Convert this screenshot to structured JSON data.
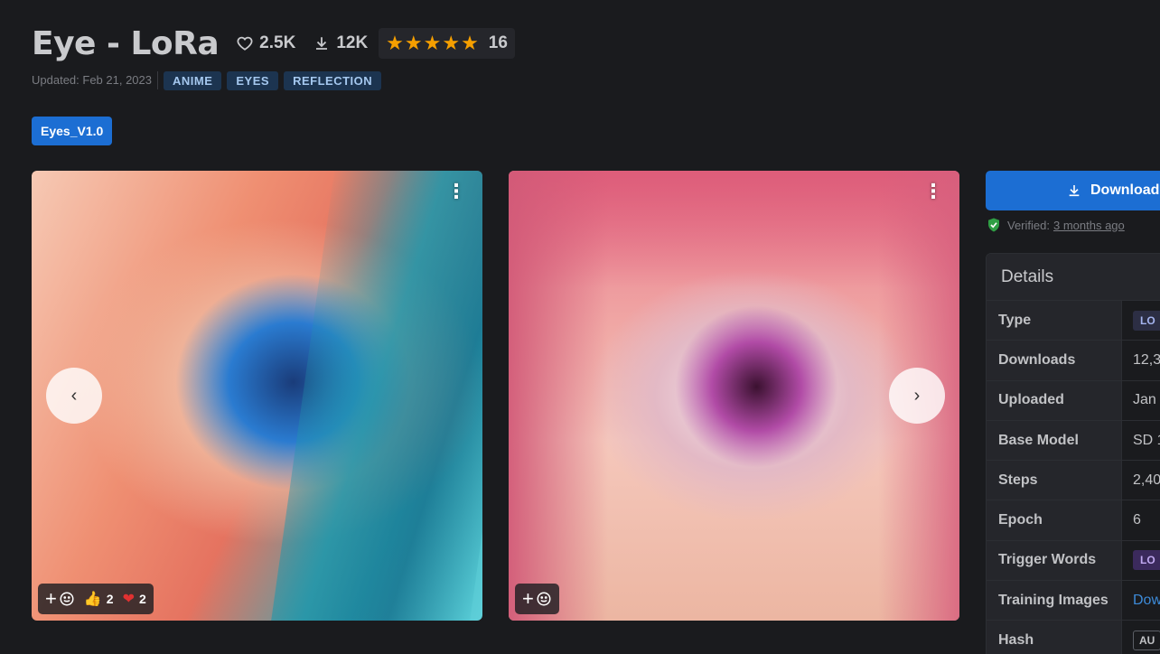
{
  "header": {
    "title": "Eye - LoRa",
    "likes": "2.5K",
    "downloads": "12K",
    "stars": "★★★★★",
    "rating_count": "16",
    "rating_value": 5,
    "updated": "Updated: Feb 21, 2023",
    "tags": [
      "ANIME",
      "EYES",
      "REFLECTION"
    ]
  },
  "version": {
    "label": "Eyes_V1.0"
  },
  "gallery": {
    "cards": [
      {
        "reactions": [
          {
            "icon": "👍",
            "count": "2"
          },
          {
            "icon": "❤",
            "count": "2"
          }
        ]
      },
      {
        "reactions": []
      }
    ],
    "prev_symbol": "‹",
    "next_symbol": "›",
    "menu_symbol": "⋮",
    "add_symbol": "+"
  },
  "sidebar": {
    "download_label": "Download",
    "verified_label": "Verified:",
    "verified_time": "3 months ago",
    "details_title": "Details",
    "details": [
      {
        "key": "Type",
        "value": "LO",
        "style": "pill"
      },
      {
        "key": "Downloads",
        "value": "12,3",
        "style": "text"
      },
      {
        "key": "Uploaded",
        "value": "Jan",
        "style": "text"
      },
      {
        "key": "Base Model",
        "value": "SD 1",
        "style": "text"
      },
      {
        "key": "Steps",
        "value": "2,40",
        "style": "text"
      },
      {
        "key": "Epoch",
        "value": "6",
        "style": "text"
      },
      {
        "key": "Trigger Words",
        "value": "LO",
        "style": "pill-purple"
      },
      {
        "key": "Training Images",
        "value": "Dow",
        "style": "linkv"
      },
      {
        "key": "Hash",
        "value": "AU",
        "style": "pill-outline"
      }
    ]
  },
  "colors": {
    "accent": "#1c6ed3",
    "star": "#f59f00",
    "background": "#1a1b1e",
    "verified": "#2f9e44"
  }
}
